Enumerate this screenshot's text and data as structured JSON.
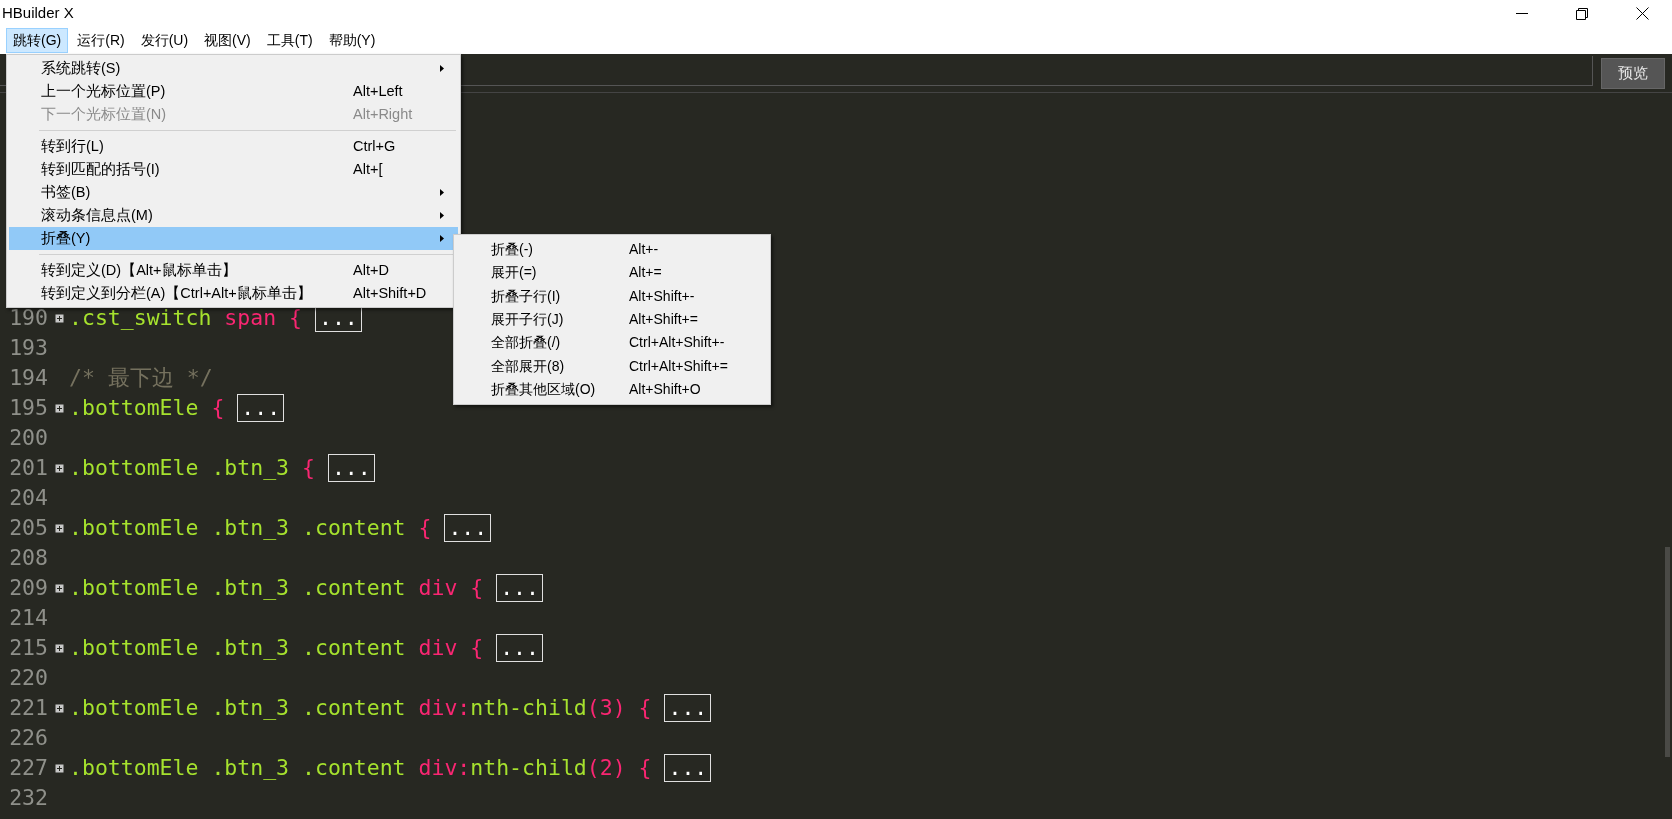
{
  "window": {
    "title": "HBuilder X"
  },
  "menubar": [
    {
      "label": "跳转(G)",
      "selected": true
    },
    {
      "label": "运行(R)",
      "selected": false
    },
    {
      "label": "发行(U)",
      "selected": false
    },
    {
      "label": "视图(V)",
      "selected": false
    },
    {
      "label": "工具(T)",
      "selected": false
    },
    {
      "label": "帮助(Y)",
      "selected": false
    }
  ],
  "toolbar": {
    "preview_button": "预览"
  },
  "menu": [
    {
      "kind": "item",
      "label": "系统跳转(S)",
      "submenu": true,
      "disabled": false,
      "selected": false
    },
    {
      "kind": "item",
      "label": "上一个光标位置(P)",
      "shortcut": "Alt+Left",
      "submenu": false,
      "disabled": false,
      "selected": false
    },
    {
      "kind": "item",
      "label": "下一个光标位置(N)",
      "shortcut": "Alt+Right",
      "submenu": false,
      "disabled": true,
      "selected": false
    },
    {
      "kind": "separator"
    },
    {
      "kind": "item",
      "label": "转到行(L)",
      "shortcut": "Ctrl+G",
      "submenu": false,
      "disabled": false,
      "selected": false
    },
    {
      "kind": "item",
      "label": "转到匹配的括号(I)",
      "shortcut": "Alt+[",
      "submenu": false,
      "disabled": false,
      "selected": false
    },
    {
      "kind": "item",
      "label": "书签(B)",
      "submenu": true,
      "disabled": false,
      "selected": false
    },
    {
      "kind": "item",
      "label": "滚动条信息点(M)",
      "submenu": true,
      "disabled": false,
      "selected": false
    },
    {
      "kind": "item",
      "label": "折叠(Y)",
      "submenu": true,
      "disabled": false,
      "selected": true
    },
    {
      "kind": "separator"
    },
    {
      "kind": "item",
      "label": "转到定义(D)【Alt+鼠标单击】",
      "shortcut": "Alt+D",
      "submenu": false,
      "disabled": false,
      "selected": false
    },
    {
      "kind": "item",
      "label": "转到定义到分栏(A)【Ctrl+Alt+鼠标单击】",
      "shortcut": "Alt+Shift+D",
      "submenu": false,
      "disabled": false,
      "selected": false
    }
  ],
  "submenu": [
    {
      "label": "折叠(-)",
      "shortcut": "Alt+-"
    },
    {
      "label": "展开(=)",
      "shortcut": "Alt+="
    },
    {
      "label": "折叠子行(I)",
      "shortcut": "Alt+Shift+-"
    },
    {
      "label": "展开子行(J)",
      "shortcut": "Alt+Shift+="
    },
    {
      "label": "全部折叠(/)",
      "shortcut": "Ctrl+Alt+Shift+-"
    },
    {
      "label": "全部展开(8)",
      "shortcut": "Ctrl+Alt+Shift+="
    },
    {
      "label": "折叠其他区域(O)",
      "shortcut": "Alt+Shift+O"
    }
  ],
  "code": [
    {
      "number": "190",
      "folded": true,
      "tokens": [
        {
          "kind": "selector",
          "text": ".cst_switch"
        },
        {
          "kind": "tag",
          "text": " span"
        },
        {
          "kind": "brace",
          "text": " { "
        },
        {
          "kind": "fold",
          "text": "..."
        }
      ]
    },
    {
      "number": "193",
      "folded": false
    },
    {
      "number": "194",
      "folded": false,
      "tokens": [
        {
          "kind": "comment",
          "text": "/* 最下边 */"
        }
      ]
    },
    {
      "number": "195",
      "folded": true,
      "tokens": [
        {
          "kind": "selector",
          "text": ".bottomEle"
        },
        {
          "kind": "brace",
          "text": " { "
        },
        {
          "kind": "fold",
          "text": "..."
        }
      ]
    },
    {
      "number": "200",
      "folded": false
    },
    {
      "number": "201",
      "folded": true,
      "tokens": [
        {
          "kind": "selector",
          "text": ".bottomEle .btn_3"
        },
        {
          "kind": "brace",
          "text": " { "
        },
        {
          "kind": "fold",
          "text": "..."
        }
      ]
    },
    {
      "number": "204",
      "folded": false
    },
    {
      "number": "205",
      "folded": true,
      "tokens": [
        {
          "kind": "selector",
          "text": ".bottomEle .btn_3 .content"
        },
        {
          "kind": "brace",
          "text": " { "
        },
        {
          "kind": "fold",
          "text": "..."
        }
      ]
    },
    {
      "number": "208",
      "folded": false
    },
    {
      "number": "209",
      "folded": true,
      "tokens": [
        {
          "kind": "selector",
          "text": ".bottomEle .btn_3 .content"
        },
        {
          "kind": "tag",
          "text": " div"
        },
        {
          "kind": "brace",
          "text": " { "
        },
        {
          "kind": "fold",
          "text": "..."
        }
      ]
    },
    {
      "number": "214",
      "folded": false
    },
    {
      "number": "215",
      "folded": true,
      "tokens": [
        {
          "kind": "selector",
          "text": ".bottomEle .btn_3 .content"
        },
        {
          "kind": "tag",
          "text": " div"
        },
        {
          "kind": "brace",
          "text": " { "
        },
        {
          "kind": "fold",
          "text": "..."
        }
      ]
    },
    {
      "number": "220",
      "folded": false
    },
    {
      "number": "221",
      "folded": true,
      "tokens": [
        {
          "kind": "selector",
          "text": ".bottomEle .btn_3 .content"
        },
        {
          "kind": "tag",
          "text": " div:"
        },
        {
          "kind": "selector",
          "text": "nth-child"
        },
        {
          "kind": "tag",
          "text": "(3)"
        },
        {
          "kind": "brace",
          "text": " { "
        },
        {
          "kind": "fold",
          "text": "..."
        }
      ]
    },
    {
      "number": "226",
      "folded": false
    },
    {
      "number": "227",
      "folded": true,
      "tokens": [
        {
          "kind": "selector",
          "text": ".bottomEle .btn_3 .content"
        },
        {
          "kind": "tag",
          "text": " div:"
        },
        {
          "kind": "selector",
          "text": "nth-child"
        },
        {
          "kind": "tag",
          "text": "(2)"
        },
        {
          "kind": "brace",
          "text": " { "
        },
        {
          "kind": "fold",
          "text": "..."
        }
      ]
    },
    {
      "number": "232",
      "folded": false
    }
  ]
}
